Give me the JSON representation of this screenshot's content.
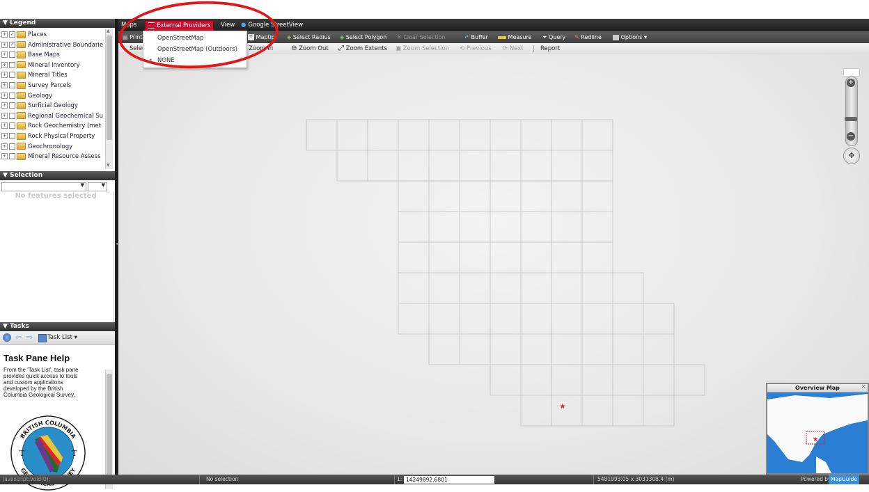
{
  "legend": {
    "title": "▼ Legend",
    "items": [
      {
        "label": "Places",
        "checked": true
      },
      {
        "label": "Administrative Boundarie",
        "checked": true
      },
      {
        "label": "Base Maps",
        "checked": false
      },
      {
        "label": "Mineral Inventory",
        "checked": false
      },
      {
        "label": "Mineral Titles",
        "checked": false
      },
      {
        "label": "Survey Parcels",
        "checked": false
      },
      {
        "label": "Geology",
        "checked": false
      },
      {
        "label": "Surficial Geology",
        "checked": false
      },
      {
        "label": "Regional Geochemical Su",
        "checked": false
      },
      {
        "label": "Rock Geochemistry (met",
        "checked": false
      },
      {
        "label": "Rock Physical Property",
        "checked": false
      },
      {
        "label": "Geochronology",
        "checked": false
      },
      {
        "label": "Mineral Resource Assess",
        "checked": false
      }
    ]
  },
  "selection": {
    "title": "▼ Selection",
    "empty_text": "No features selected"
  },
  "tasks": {
    "title": "▼ Tasks",
    "task_list_label": "Task List ▾",
    "help_title": "Task Pane Help",
    "help_lines": [
      "From the 'Task List', task pane",
      "provides quick access to tools",
      "and custom applications",
      "developed by the British",
      "Columbia Geological Survey."
    ],
    "seal_top": "BRITISH COLUMBIA",
    "seal_bottom": "GEOLOGICAL SURVEY"
  },
  "menubar": {
    "maps": "Maps",
    "external_providers": "External Providers",
    "view": "View",
    "streetview": "Google StreetView"
  },
  "toolbar1": {
    "print": "Print",
    "maptip": "Maptip",
    "select_radius": "Select Radius",
    "select_polygon": "Select Polygon",
    "clear_selection": "Clear Selection",
    "buffer": "Buffer",
    "measure": "Measure",
    "query": "Query",
    "redline": "Redline",
    "options": "Options ▾"
  },
  "toolbar2": {
    "select": "Select",
    "zoom_in": "Zoom In",
    "zoom_out": "Zoom Out",
    "zoom_extents": "Zoom Extents",
    "zoom_selection": "Zoom Selection",
    "previous": "Previous",
    "next": "Next",
    "report": "Report"
  },
  "dropdown": {
    "options": [
      {
        "label": "OpenStreetMap",
        "selected": false
      },
      {
        "label": "OpenStreetMap (Outdoors)",
        "selected": false
      },
      {
        "label": "NONE",
        "selected": true
      }
    ]
  },
  "overview": {
    "title": "Overview Map",
    "close": "×"
  },
  "status": {
    "left": "javascript:void(0);",
    "selection": "No selection",
    "scale_prefix": "1:",
    "scale_value": "14249892.6801",
    "size": "5481993.05 x 3031308.4 (m)",
    "powered": "Powered by",
    "mapguide": "MapGuide"
  },
  "colors": {
    "accent_red": "#e01818",
    "toolbar_dark": "#2e2e2e",
    "menu_highlight": "#c8102e"
  }
}
